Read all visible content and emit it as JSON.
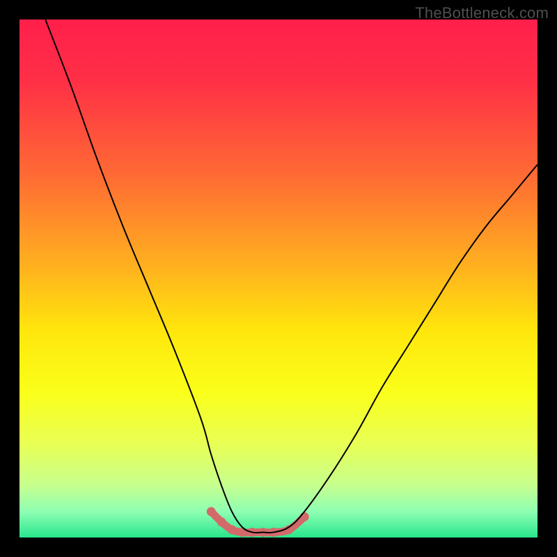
{
  "watermark": "TheBottleneck.com",
  "colors": {
    "frame": "#000000",
    "gradient_stops": [
      {
        "offset": 0.0,
        "color": "#ff1f4b"
      },
      {
        "offset": 0.12,
        "color": "#ff3046"
      },
      {
        "offset": 0.3,
        "color": "#ff6a34"
      },
      {
        "offset": 0.48,
        "color": "#ffb21e"
      },
      {
        "offset": 0.6,
        "color": "#ffe60c"
      },
      {
        "offset": 0.72,
        "color": "#faff1a"
      },
      {
        "offset": 0.82,
        "color": "#e8ff55"
      },
      {
        "offset": 0.9,
        "color": "#c6ff8f"
      },
      {
        "offset": 0.95,
        "color": "#8effb3"
      },
      {
        "offset": 1.0,
        "color": "#28e58e"
      }
    ],
    "line_color": "#000000",
    "marker_color": "#d36a6a"
  },
  "chart_data": {
    "type": "line",
    "title": "",
    "xlabel": "",
    "ylabel": "",
    "xlim": [
      0,
      100
    ],
    "ylim": [
      0,
      100
    ],
    "series": [
      {
        "name": "bottleneck-curve",
        "x": [
          5,
          10,
          15,
          20,
          25,
          30,
          35,
          37,
          39,
          41,
          43,
          45,
          47,
          49,
          52,
          55,
          60,
          65,
          70,
          75,
          80,
          85,
          90,
          95,
          100
        ],
        "y": [
          100,
          87,
          73,
          60,
          48,
          36,
          23,
          16,
          10,
          5,
          2,
          1,
          1,
          1,
          2,
          5,
          12,
          20,
          29,
          37,
          45,
          53,
          60,
          66,
          72
        ]
      }
    ],
    "markers": {
      "name": "valley-highlight",
      "x": [
        37,
        39,
        41,
        43,
        45,
        47,
        49,
        52,
        55
      ],
      "y": [
        5,
        3,
        1.5,
        1,
        1,
        1,
        1,
        1.5,
        4
      ]
    }
  }
}
